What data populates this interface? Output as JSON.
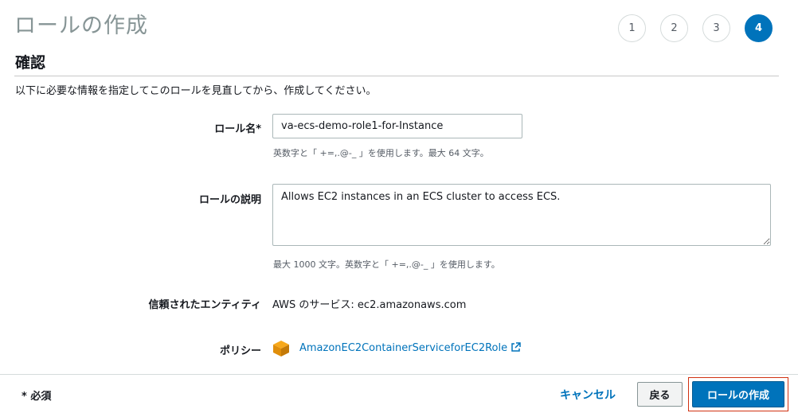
{
  "header": {
    "title": "ロールの作成",
    "steps": [
      "1",
      "2",
      "3",
      "4"
    ],
    "active_step": "4"
  },
  "section": {
    "title": "確認",
    "intro": "以下に必要な情報を指定してこのロールを見直してから、作成してください。"
  },
  "form": {
    "role_name": {
      "label": "ロール名*",
      "value": "va-ecs-demo-role1-for-Instance",
      "hint": "英数字と「 +=,.@-_ 」を使用します。最大 64 文字。"
    },
    "role_description": {
      "label": "ロールの説明",
      "value": "Allows EC2 instances in an ECS cluster to access ECS.",
      "hint": "最大 1000 文字。英数字と「 +=,.@-_ 」を使用します。"
    },
    "trusted_entity": {
      "label": "信頼されたエンティティ",
      "value": "AWS のサービス: ec2.amazonaws.com"
    },
    "policy": {
      "label": "ポリシー",
      "link": "AmazonEC2ContainerServiceforEC2Role",
      "icon": "aws-policy-cube-icon"
    }
  },
  "footer": {
    "required_note": "* 必須",
    "cancel_label": "キャンセル",
    "back_label": "戻る",
    "create_label": "ロールの作成"
  },
  "colors": {
    "accent": "#0073bb",
    "highlight_outline": "#d13212",
    "policy_icon": "#f7a81b"
  }
}
